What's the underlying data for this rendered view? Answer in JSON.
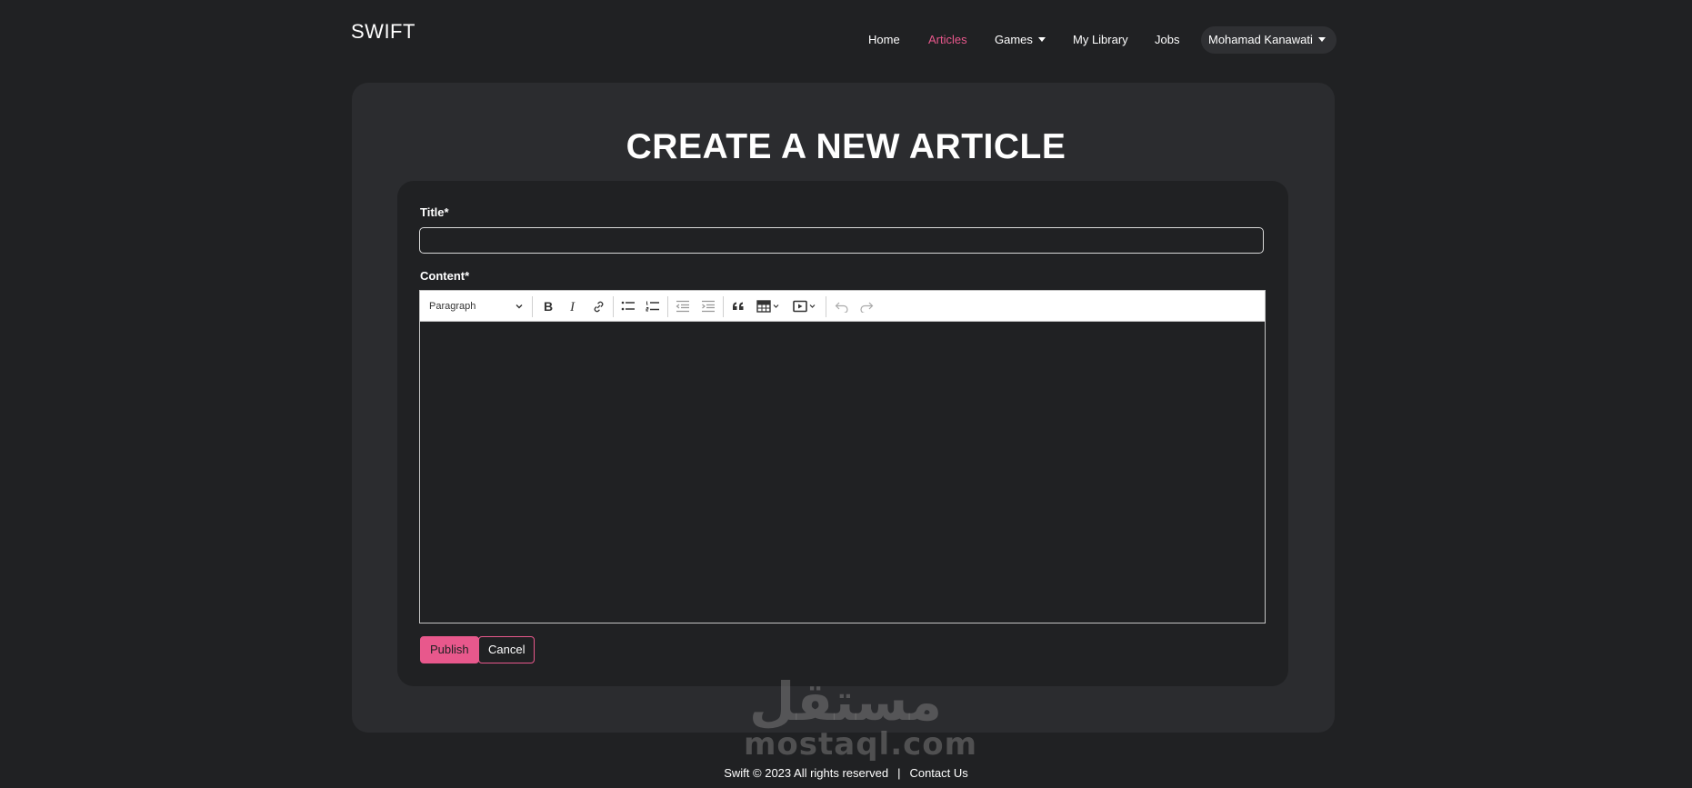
{
  "brand": "SWIFT",
  "nav": {
    "home": "Home",
    "articles": "Articles",
    "games": "Games",
    "library": "My Library",
    "jobs": "Jobs",
    "user": "Mohamad Kanawati",
    "active_color": "#e8588c"
  },
  "page": {
    "title": "CREATE A NEW ARTICLE"
  },
  "form": {
    "title_label": "Title*",
    "title_value": "",
    "content_label": "Content*",
    "paragraph_select": "Paragraph",
    "publish_label": "Publish",
    "cancel_label": "Cancel"
  },
  "toolbar_icons": [
    "bold-icon",
    "italic-icon",
    "link-icon",
    "bulleted-list-icon",
    "numbered-list-icon",
    "outdent-icon",
    "indent-icon",
    "blockquote-icon",
    "table-icon",
    "media-embed-icon",
    "undo-icon",
    "redo-icon"
  ],
  "footer": {
    "copyright": "Swift © 2023 All rights reserved",
    "separator": "|",
    "contact": "Contact Us"
  },
  "watermark": {
    "arabic": "مستقل",
    "latin": "mostaql.com"
  },
  "colors": {
    "background": "#202123",
    "card": "#2b2c2f",
    "accent": "#e8588c"
  }
}
